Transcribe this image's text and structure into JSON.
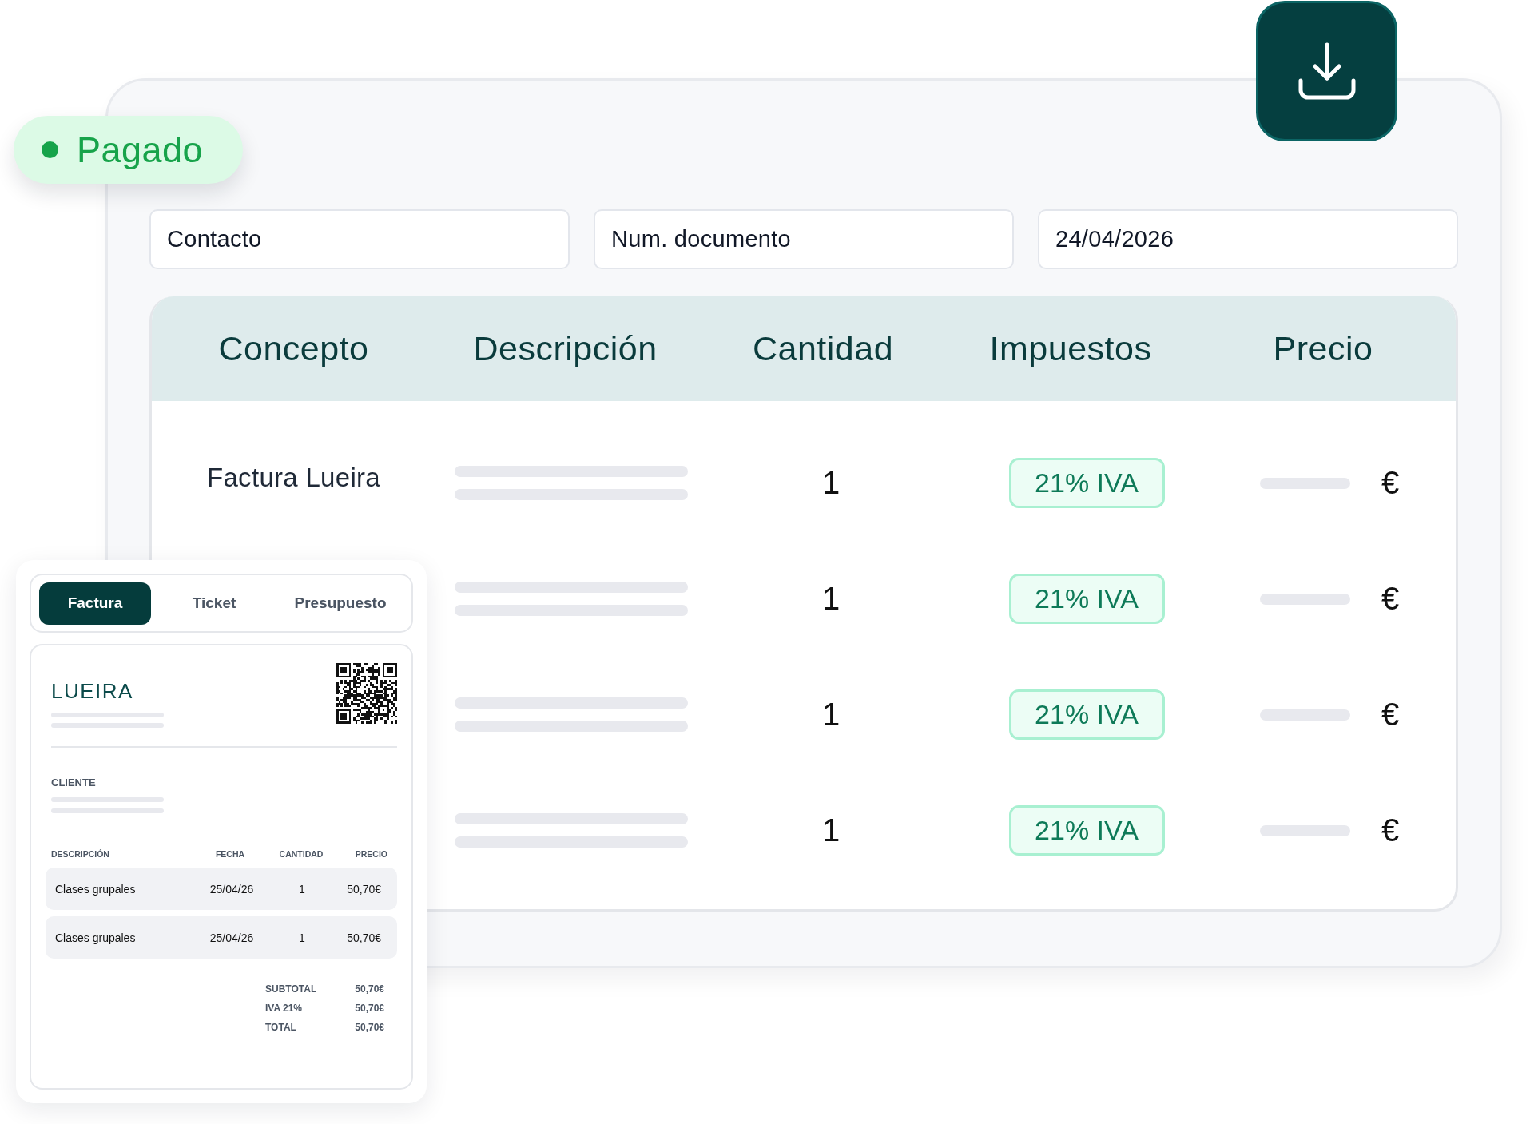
{
  "status_badge": {
    "label": "Pagado"
  },
  "fields": [
    {
      "placeholder": "Contacto"
    },
    {
      "placeholder": "Num. documento"
    },
    {
      "value": "24/04/2026"
    }
  ],
  "table": {
    "columns": [
      "Concepto",
      "Descripción",
      "Cantidad",
      "Impuestos",
      "Precio"
    ],
    "rows": [
      {
        "concept": "Factura Lueira",
        "quantity": "1",
        "tax": "21% IVA",
        "currency": "€"
      },
      {
        "quantity": "1",
        "tax": "21% IVA",
        "currency": "€"
      },
      {
        "quantity": "1",
        "tax": "21% IVA",
        "currency": "€"
      },
      {
        "quantity": "1",
        "tax": "21% IVA",
        "currency": "€"
      }
    ]
  },
  "invoice": {
    "tabs": [
      {
        "label": "Factura",
        "selected": true
      },
      {
        "label": "Ticket",
        "selected": false
      },
      {
        "label": "Presupuesto",
        "selected": false
      }
    ],
    "logo": "LUEIRA",
    "client_label": "CLIENTE",
    "columns": [
      "DESCRIPCIÓN",
      "FECHA",
      "CANTIDAD",
      "PRECIO"
    ],
    "rows": [
      {
        "description": "Clases grupales",
        "date": "25/04/26",
        "quantity": "1",
        "price": "50,70€"
      },
      {
        "description": "Clases grupales",
        "date": "25/04/26",
        "quantity": "1",
        "price": "50,70€"
      }
    ],
    "totals": [
      {
        "label": "SUBTOTAL",
        "value": "50,70€"
      },
      {
        "label": "IVA 21%",
        "value": "50,70€"
      },
      {
        "label": "TOTAL",
        "value": "50,70€"
      }
    ]
  }
}
